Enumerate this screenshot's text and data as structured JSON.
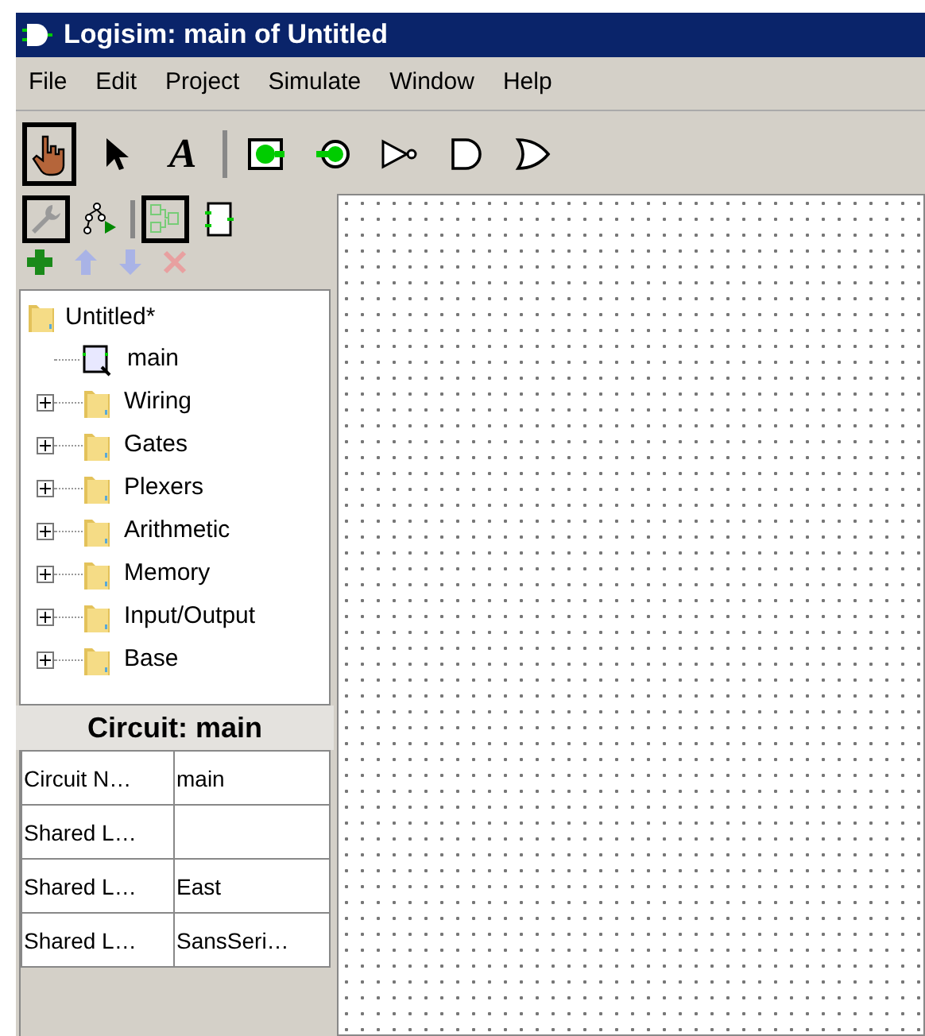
{
  "window": {
    "title": "Logisim: main of Untitled"
  },
  "menu": [
    "File",
    "Edit",
    "Project",
    "Simulate",
    "Window",
    "Help"
  ],
  "toolbar": [
    {
      "kind": "poke",
      "selected": true
    },
    {
      "kind": "select",
      "selected": false
    },
    {
      "kind": "text",
      "label": "A",
      "selected": false
    },
    {
      "kind": "separator"
    },
    {
      "kind": "input",
      "selected": false
    },
    {
      "kind": "output",
      "selected": false
    },
    {
      "kind": "not",
      "selected": false
    },
    {
      "kind": "and",
      "selected": false
    },
    {
      "kind": "or",
      "selected": false
    }
  ],
  "explorer_toolbar": [
    {
      "kind": "edit",
      "selected": true
    },
    {
      "kind": "simulate",
      "selected": false
    },
    {
      "kind": "separator"
    },
    {
      "kind": "layout",
      "selected": true
    },
    {
      "kind": "appearance",
      "selected": false
    }
  ],
  "project_actions": [
    {
      "kind": "add",
      "disabled": false
    },
    {
      "kind": "up",
      "disabled": true
    },
    {
      "kind": "down",
      "disabled": true
    },
    {
      "kind": "delete",
      "disabled": true
    }
  ],
  "tree": {
    "label": "Untitled*",
    "children": [
      {
        "label": "main",
        "kind": "circuit"
      },
      {
        "label": "Wiring",
        "kind": "library",
        "expanded": false
      },
      {
        "label": "Gates",
        "kind": "library",
        "expanded": false
      },
      {
        "label": "Plexers",
        "kind": "library",
        "expanded": false
      },
      {
        "label": "Arithmetic",
        "kind": "library",
        "expanded": false
      },
      {
        "label": "Memory",
        "kind": "library",
        "expanded": false
      },
      {
        "label": "Input/Output",
        "kind": "library",
        "expanded": false
      },
      {
        "label": "Base",
        "kind": "library",
        "expanded": false
      }
    ]
  },
  "attributes": {
    "title": "Circuit: main",
    "rows": [
      {
        "name": "Circuit N…",
        "value": "main"
      },
      {
        "name": "Shared L…",
        "value": ""
      },
      {
        "name": "Shared L…",
        "value": "East"
      },
      {
        "name": "Shared L…",
        "value": "SansSeri…"
      }
    ]
  }
}
